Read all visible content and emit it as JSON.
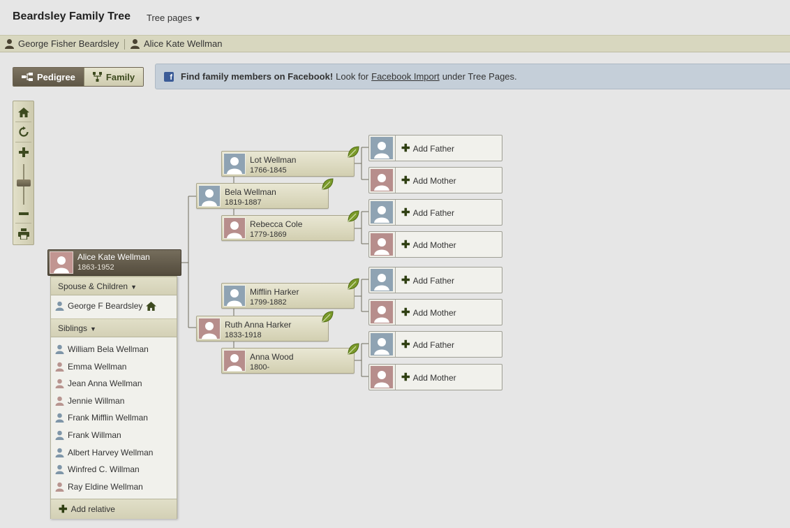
{
  "header": {
    "title": "Beardsley Family Tree",
    "tree_pages": "Tree pages"
  },
  "person_bar": {
    "person1": "George Fisher Beardsley",
    "person2": "Alice Kate Wellman"
  },
  "view_toggle": {
    "pedigree": "Pedigree",
    "family": "Family"
  },
  "facebook_notice": {
    "bold": "Find family members on Facebook!",
    "text_before": "Look for",
    "link": "Facebook Import",
    "text_after": "under Tree Pages."
  },
  "root": {
    "name": "Alice Kate Wellman",
    "dates": "1863-1952"
  },
  "relatives_panel": {
    "spouse_header": "Spouse & Children",
    "spouse": "George F Beardsley",
    "siblings_header": "Siblings",
    "siblings": [
      {
        "name": "William Bela Wellman",
        "gender": "male"
      },
      {
        "name": "Emma Wellman",
        "gender": "female"
      },
      {
        "name": "Jean Anna Wellman",
        "gender": "female"
      },
      {
        "name": "Jennie Willman",
        "gender": "female"
      },
      {
        "name": "Frank Mifflin Wellman",
        "gender": "male"
      },
      {
        "name": "Frank Willman",
        "gender": "male"
      },
      {
        "name": "Albert Harvey Wellman",
        "gender": "male"
      },
      {
        "name": "Winfred C. Willman",
        "gender": "male"
      },
      {
        "name": "Ray Eldine Wellman",
        "gender": "female"
      }
    ],
    "add_relative": "Add relative"
  },
  "ancestors": {
    "father": {
      "name": "Bela Wellman",
      "dates": "1819-1887"
    },
    "mother": {
      "name": "Ruth Anna Harker",
      "dates": "1833-1918"
    },
    "paternal_grandfather": {
      "name": "Lot Wellman",
      "dates": "1766-1845"
    },
    "paternal_grandmother": {
      "name": "Rebecca Cole",
      "dates": "1779-1869"
    },
    "maternal_grandfather": {
      "name": "Mifflin Harker",
      "dates": "1799-1882"
    },
    "maternal_grandmother": {
      "name": "Anna Wood",
      "dates": "1800-"
    }
  },
  "add_labels": {
    "father": "Add Father",
    "mother": "Add Mother"
  },
  "colors": {
    "male_thumb": "#8fa3b3",
    "female_thumb": "#b78e8c",
    "card_dark": "#5f5746",
    "facebook": "#3b5b97",
    "leaf": "#7a9a2a"
  }
}
